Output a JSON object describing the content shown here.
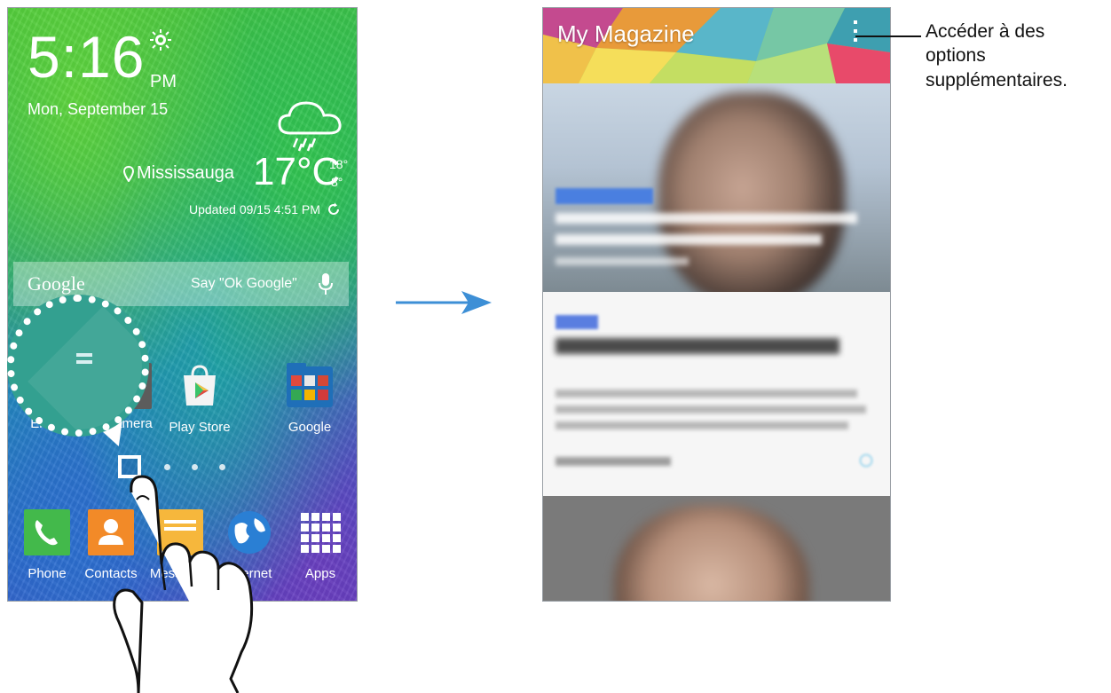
{
  "home": {
    "time": "5:16",
    "ampm": "PM",
    "date": "Mon, September 15",
    "location": "Mississauga",
    "temperature": "17°C",
    "temp_high": "18°",
    "temp_low": "8°",
    "updated": "Updated 09/15 4:51 PM",
    "search": {
      "logo": "Google",
      "hint": "Say \"Ok Google\""
    },
    "apps": [
      {
        "label": "Email",
        "icon": "email-icon"
      },
      {
        "label": "Camera",
        "icon": "camera-icon"
      },
      {
        "label": "Play Store",
        "icon": "play-store-icon"
      },
      {
        "label": "Google",
        "icon": "google-folder-icon"
      }
    ],
    "dock": [
      {
        "label": "Phone",
        "icon": "phone-icon"
      },
      {
        "label": "Contacts",
        "icon": "contacts-icon"
      },
      {
        "label": "Messages",
        "icon": "messages-icon"
      },
      {
        "label": "Internet",
        "icon": "globe-icon"
      },
      {
        "label": "Apps",
        "icon": "apps-grid-icon"
      }
    ],
    "page_count": 4,
    "current_page": 1
  },
  "magazine": {
    "title": "My Magazine"
  },
  "callout": {
    "text": "Accéder à des options supplémentaires."
  },
  "colors": {
    "wallpaper_green": "#49c63a",
    "wallpaper_blue": "#2a64c8",
    "accent_blue": "#4a7fe0",
    "arrow": "#3d8fd6"
  }
}
